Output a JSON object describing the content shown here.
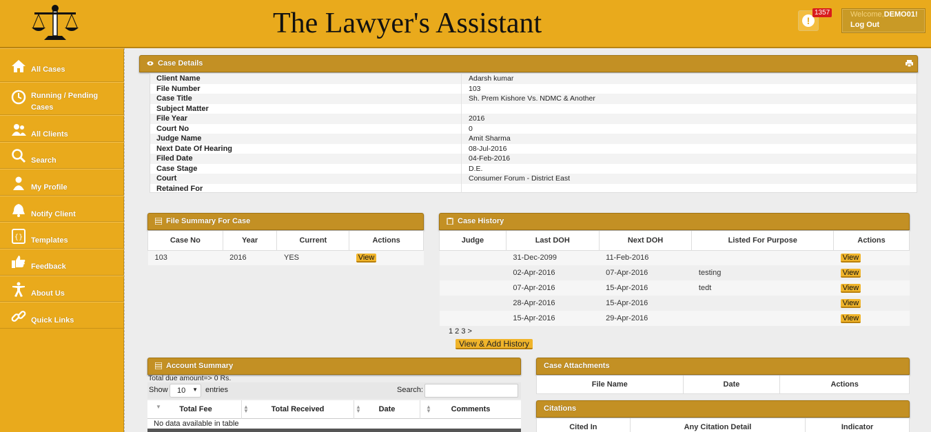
{
  "header": {
    "title": "The Lawyer's Assistant",
    "notification_count": "1357",
    "welcome_prefix": "Welcome,",
    "username": "DEMO01!",
    "logout_label": "Log Out"
  },
  "sidebar": {
    "items": [
      {
        "label": "All Cases",
        "icon": "home-icon"
      },
      {
        "label": "Running / Pending Cases",
        "icon": "clock-icon"
      },
      {
        "label": "All Clients",
        "icon": "users-icon"
      },
      {
        "label": "Search",
        "icon": "search-icon"
      },
      {
        "label": "My Profile",
        "icon": "profile-icon"
      },
      {
        "label": "Notify Client",
        "icon": "bell-icon"
      },
      {
        "label": "Templates",
        "icon": "template-icon"
      },
      {
        "label": "Feedback",
        "icon": "thumbs-up-icon"
      },
      {
        "label": "About Us",
        "icon": "person-icon"
      },
      {
        "label": "Quick Links",
        "icon": "link-icon"
      }
    ]
  },
  "case_details": {
    "title": "Case Details",
    "rows": [
      {
        "key": "Client Name",
        "value": "Adarsh kumar"
      },
      {
        "key": "File Number",
        "value": "103"
      },
      {
        "key": "Case Title",
        "value": "Sh. Prem Kishore Vs. NDMC & Another"
      },
      {
        "key": "Subject Matter",
        "value": ""
      },
      {
        "key": "File Year",
        "value": "2016"
      },
      {
        "key": "Court No",
        "value": "0"
      },
      {
        "key": "Judge Name",
        "value": "Amit Sharma"
      },
      {
        "key": "Next Date Of Hearing",
        "value": "08-Jul-2016"
      },
      {
        "key": "Filed Date",
        "value": "04-Feb-2016"
      },
      {
        "key": "Case Stage",
        "value": "D.E."
      },
      {
        "key": "Court",
        "value": "Consumer Forum - District East"
      },
      {
        "key": "Retained For",
        "value": ""
      }
    ]
  },
  "file_summary": {
    "title": "File Summary For Case",
    "columns": [
      "Case No",
      "Year",
      "Current",
      "Actions"
    ],
    "rows": [
      {
        "case_no": "103",
        "year": "2016",
        "current": "YES",
        "action": "View"
      }
    ]
  },
  "case_history": {
    "title": "Case History",
    "columns": [
      "Judge",
      "Last DOH",
      "Next DOH",
      "Listed For Purpose",
      "Actions"
    ],
    "rows": [
      {
        "judge": "",
        "last": "31-Dec-2099",
        "next": "11-Feb-2016",
        "purpose": "",
        "action": "View"
      },
      {
        "judge": "",
        "last": "02-Apr-2016",
        "next": "07-Apr-2016",
        "purpose": "testing",
        "action": "View"
      },
      {
        "judge": "",
        "last": "07-Apr-2016",
        "next": "15-Apr-2016",
        "purpose": "tedt",
        "action": "View"
      },
      {
        "judge": "",
        "last": "28-Apr-2016",
        "next": "15-Apr-2016",
        "purpose": "",
        "action": "View"
      },
      {
        "judge": "",
        "last": "15-Apr-2016",
        "next": "29-Apr-2016",
        "purpose": "",
        "action": "View"
      }
    ],
    "pager": "1 2 3 >",
    "view_add_label": "View & Add History"
  },
  "account_summary": {
    "title": "Account Summary",
    "due_text": "Total due amount=> 0 Rs.",
    "show_label": "Show",
    "page_size": "10",
    "entries_label": "entries",
    "search_label": "Search:",
    "columns": [
      "Total Fee",
      "Total Received",
      "Date",
      "Comments"
    ],
    "empty_text": "No data available in table"
  },
  "attachments": {
    "title": "Case Attachments",
    "columns": [
      "File Name",
      "Date",
      "Actions"
    ]
  },
  "citations": {
    "title": "Citations",
    "columns": [
      "Cited In",
      "Any Citation Detail",
      "Indicator"
    ]
  },
  "colors": {
    "brand": "#e9aa1c",
    "panel_header": "#c39024",
    "button": "#f0b42a",
    "badge": "#d81c1c"
  }
}
